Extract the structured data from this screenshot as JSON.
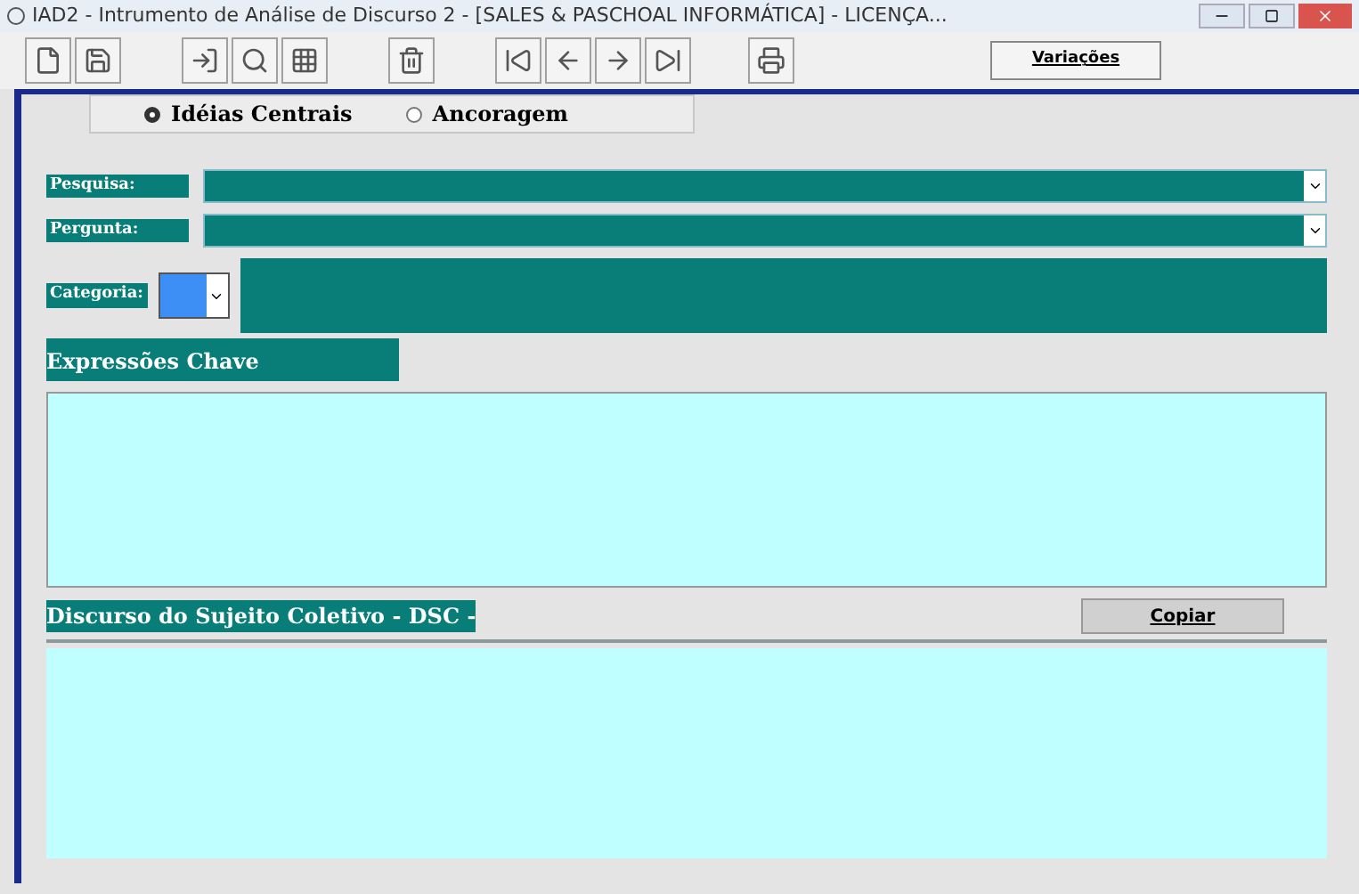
{
  "window": {
    "title": "IAD2 - Intrumento de Análise de Discurso 2  -  [SALES & PASCHOAL INFORMÁTICA]  - LICENÇA..."
  },
  "toolbar": {
    "variations_button": "Variações"
  },
  "modes": [
    {
      "label": "Idéias Centrais",
      "selected": true
    },
    {
      "label": "Ancoragem",
      "selected": false
    }
  ],
  "fields": [
    {
      "label": "Pesquisa:"
    },
    {
      "label": "Pergunta:"
    }
  ],
  "category": {
    "label": "Categoria:",
    "color": "#3d8ef5"
  },
  "key_expressions": {
    "label": "Expressões Chave"
  },
  "dsc": {
    "label": "Discurso do Sujeito Coletivo - DSC -",
    "copy_button": "Copiar"
  }
}
